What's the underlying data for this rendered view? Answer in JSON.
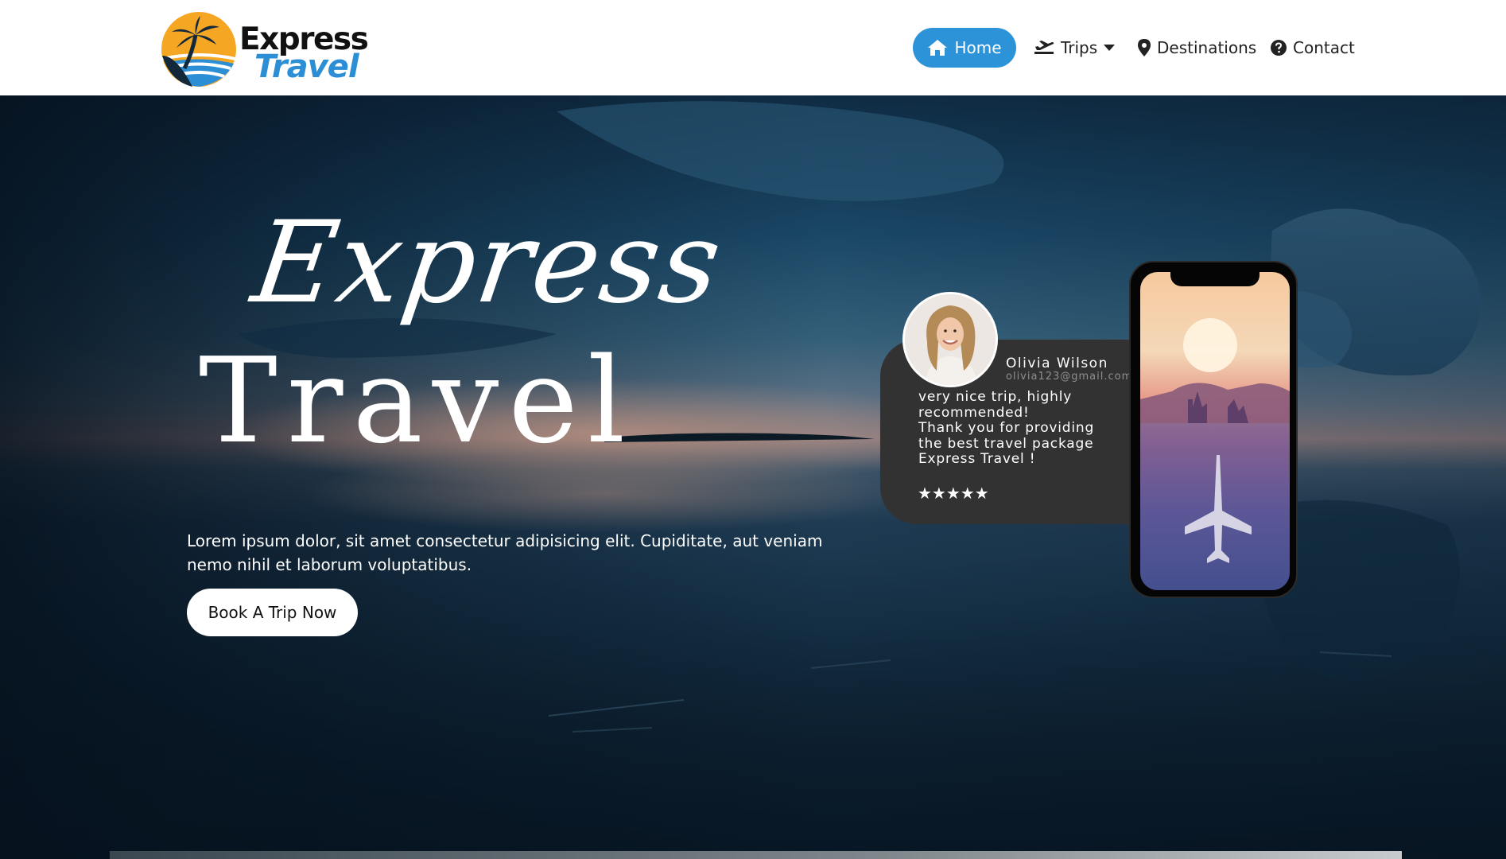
{
  "logo": {
    "word1": "Express",
    "word2": "Travel"
  },
  "nav": {
    "home": {
      "label": "Home",
      "icon": "home-icon"
    },
    "trips": {
      "label": "Trips",
      "icon": "plane-departure-icon",
      "dropdown_icon": "caret-down-icon"
    },
    "destinations": {
      "label": "Destinations",
      "icon": "map-marker-icon"
    },
    "contact": {
      "label": "Contact",
      "icon": "question-circle-icon"
    }
  },
  "hero": {
    "title_script": "Express",
    "title_main": "Travel",
    "description": "Lorem ipsum dolor, sit amet consectetur adipisicing elit. Cupiditate, aut veniam nemo nihil et laborum voluptatibus.",
    "cta_label": "Book A Trip Now"
  },
  "review": {
    "name": "Olivia Wilson",
    "email": "olivia123@gmail.com",
    "text": "very nice trip, highly\nrecommended!\nThank you for providing\nthe best travel package\nExpress Travel !",
    "rating": 5,
    "stars": "★★★★★"
  },
  "colors": {
    "accent": "#2d93d8",
    "logo_blue": "#2c8fd6",
    "logo_orange": "#f5a623",
    "card_bg": "#323232",
    "nav_bg": "#ffffff"
  }
}
